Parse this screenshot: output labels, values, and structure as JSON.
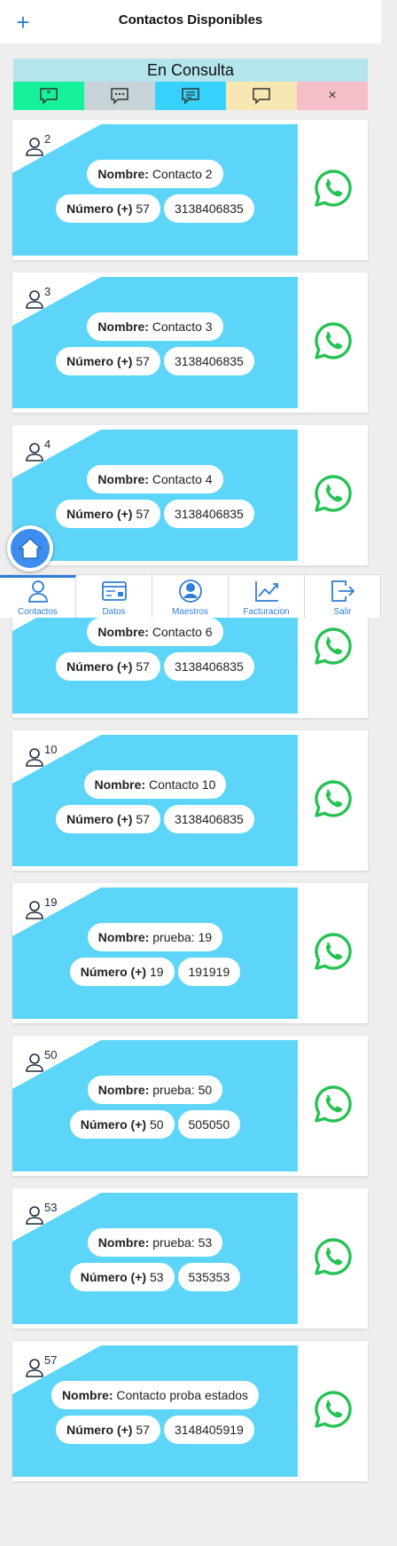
{
  "header": {
    "title": "Contactos Disponibles",
    "add_icon": "plus-icon"
  },
  "status": {
    "title": "En Consulta",
    "filters": [
      {
        "name": "quote",
        "color": "#15f29a",
        "icon": "quote-bubble-icon"
      },
      {
        "name": "dots",
        "color": "#c8d3d9",
        "icon": "dots-bubble-icon"
      },
      {
        "name": "lines",
        "color": "#36d2fb",
        "icon": "lines-bubble-icon"
      },
      {
        "name": "empty",
        "color": "#f7e7b2",
        "icon": "empty-bubble-icon"
      },
      {
        "name": "close",
        "color": "#f6bec6",
        "label": "×"
      }
    ]
  },
  "labels": {
    "name": "Nombre:",
    "number": "Número (+)"
  },
  "contacts": [
    {
      "id": "2",
      "name": "Contacto 2",
      "code": "57",
      "phone": "3138406835"
    },
    {
      "id": "3",
      "name": "Contacto 3",
      "code": "57",
      "phone": "3138406835"
    },
    {
      "id": "4",
      "name": "Contacto 4",
      "code": "57",
      "phone": "3138406835"
    },
    {
      "id": "",
      "name": "Contacto 6",
      "code": "57",
      "phone": "3138406835"
    },
    {
      "id": "10",
      "name": "Contacto 10",
      "code": "57",
      "phone": "3138406835"
    },
    {
      "id": "19",
      "name": "prueba: 19",
      "code": "19",
      "phone": "191919"
    },
    {
      "id": "50",
      "name": "prueba: 50",
      "code": "50",
      "phone": "505050"
    },
    {
      "id": "53",
      "name": "prueba: 53",
      "code": "53",
      "phone": "535353"
    },
    {
      "id": "57",
      "name": "Contacto proba estados",
      "code": "57",
      "phone": "3148405919"
    }
  ],
  "nav": [
    {
      "label": "Contactos",
      "icon": "person-icon",
      "active": true
    },
    {
      "label": "Datos",
      "icon": "id-card-icon"
    },
    {
      "label": "Maestros",
      "icon": "user-circle-icon"
    },
    {
      "label": "Facturacion",
      "icon": "chart-up-icon"
    },
    {
      "label": "Salir",
      "icon": "logout-icon"
    }
  ],
  "colors": {
    "accent": "#2f7ed8",
    "card_band": "#5dd5f9",
    "whatsapp": "#25c254"
  }
}
